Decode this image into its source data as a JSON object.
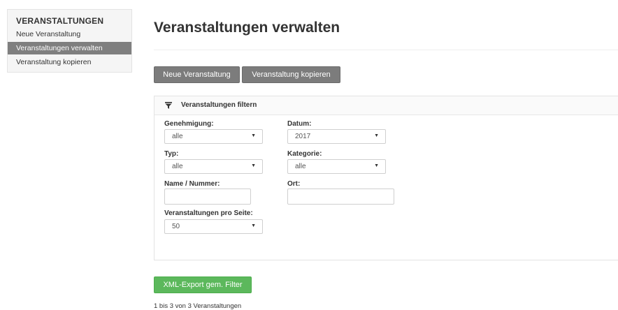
{
  "sidebar": {
    "heading": "VERANSTALTUNGEN",
    "items": [
      {
        "label": "Neue Veranstaltung"
      },
      {
        "label": "Veranstaltungen verwalten"
      },
      {
        "label": "Veranstaltung kopieren"
      }
    ]
  },
  "main": {
    "title": "Veranstaltungen verwalten",
    "buttons": {
      "new_label": "Neue Veranstaltung",
      "copy_label": "Veranstaltung kopieren",
      "export_label": "XML-Export gem. Filter"
    },
    "result_count": "1 bis 3 von 3 Veranstaltungen"
  },
  "filter": {
    "title": "Veranstaltungen filtern",
    "icon": "filter-funnel-icon",
    "genehmigung": {
      "label": "Genehmigung:",
      "value": "alle"
    },
    "datum": {
      "label": "Datum:",
      "value": "2017"
    },
    "typ": {
      "label": "Typ:",
      "value": "alle"
    },
    "kategorie": {
      "label": "Kategorie:",
      "value": "alle"
    },
    "name": {
      "label": "Name / Nummer:",
      "value": ""
    },
    "ort": {
      "label": "Ort:",
      "value": ""
    },
    "pro_seite": {
      "label": "Veranstaltungen pro Seite:",
      "value": "50"
    }
  },
  "colors": {
    "active_sidebar": "#7f7f7f",
    "gray_button": "#7c7c7c",
    "green_button": "#5cb85c"
  }
}
